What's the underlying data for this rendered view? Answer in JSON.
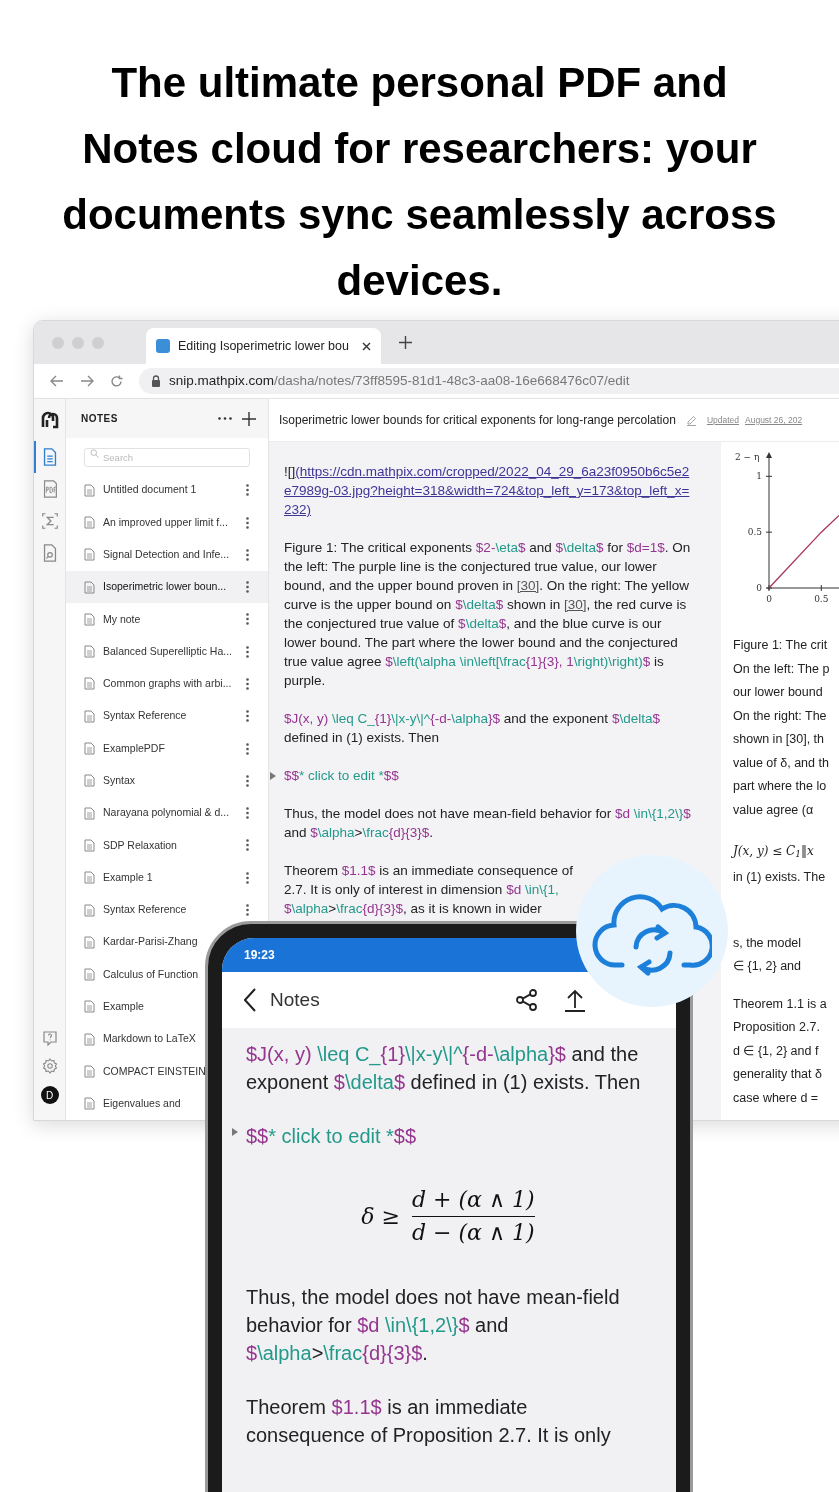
{
  "headline_lines": [
    "The ultimate personal PDF and",
    "Notes cloud for researchers: your",
    "documents sync seamlessly across",
    "devices."
  ],
  "browser": {
    "tab": {
      "title": "Editing Isoperimetric lower bou",
      "selected": true
    },
    "url_host": "snip.mathpix.com",
    "url_path": "/dasha/notes/73ff8595-81d1-48c3-aa08-16e668476c07/edit"
  },
  "rail": [
    {
      "kind": "notes",
      "selected": true
    },
    {
      "kind": "pdf",
      "selected": false
    },
    {
      "kind": "sigma",
      "selected": false
    },
    {
      "kind": "search-doc",
      "selected": false
    }
  ],
  "rail_bottom": {
    "avatar": "D"
  },
  "sidebar": {
    "title": "NOTES",
    "search_placeholder": "Search",
    "items": [
      {
        "title": "Untitled document 1",
        "selected": false
      },
      {
        "title": "An improved upper limit f...",
        "selected": false
      },
      {
        "title": "Signal Detection and Infe...",
        "selected": false
      },
      {
        "title": "Isoperimetric lower boun...",
        "selected": true
      },
      {
        "title": "My note",
        "selected": false
      },
      {
        "title": "Balanced Superelliptic Ha...",
        "selected": false
      },
      {
        "title": "Common graphs with arbi...",
        "selected": false
      },
      {
        "title": "Syntax Reference",
        "selected": false
      },
      {
        "title": "ExamplePDF",
        "selected": false
      },
      {
        "title": "Syntax",
        "selected": false
      },
      {
        "title": "Narayana polynomial & d...",
        "selected": false
      },
      {
        "title": "SDP Relaxation",
        "selected": false
      },
      {
        "title": "Example 1",
        "selected": false
      },
      {
        "title": "Syntax Reference",
        "selected": false
      },
      {
        "title": "Kardar-Parisi-Zhang",
        "selected": false
      },
      {
        "title": "Calculus of Function",
        "selected": false
      },
      {
        "title": "Example",
        "selected": false
      },
      {
        "title": "Markdown to LaTeX",
        "selected": false
      },
      {
        "title": "COMPACT EINSTEIN",
        "selected": false
      },
      {
        "title": "Eigenvalues and",
        "selected": false
      }
    ]
  },
  "document": {
    "title": "Isoperimetric lower bounds for critical exponents for long-range percolation",
    "updated_label": "Updated",
    "updated_date": "August 26, 202"
  },
  "editor": [
    {
      "kind": "para",
      "segments": [
        {
          "kind": "text",
          "text": "![]"
        },
        {
          "kind": "link",
          "text": "(https://cdn.mathpix.com/cropped/2022_04_29_6a23f0950b6c5e2e7989g-03.jpg?height=318&width=724&top_left_y=173&top_left_x=232)"
        }
      ]
    },
    {
      "kind": "para",
      "segments": [
        {
          "kind": "text",
          "text": "Figure 1: The critical exponents "
        },
        {
          "kind": "delim",
          "text": "$2-"
        },
        {
          "kind": "tex",
          "text": "\\eta"
        },
        {
          "kind": "delim",
          "text": "$"
        },
        {
          "kind": "text",
          "text": " and "
        },
        {
          "kind": "delim",
          "text": "$"
        },
        {
          "kind": "tex",
          "text": "\\delta"
        },
        {
          "kind": "delim",
          "text": "$"
        },
        {
          "kind": "text",
          "text": " for "
        },
        {
          "kind": "delim",
          "text": "$d=1$"
        },
        {
          "kind": "text",
          "text": ". On the left: The purple line is the conjectured true value, our lower bound, and the upper bound proven in "
        },
        {
          "kind": "ref",
          "text": "[30]"
        },
        {
          "kind": "text",
          "text": ". On the right: The yellow curve is the upper bound on "
        },
        {
          "kind": "delim",
          "text": "$"
        },
        {
          "kind": "tex",
          "text": "\\delta"
        },
        {
          "kind": "delim",
          "text": "$"
        },
        {
          "kind": "text",
          "text": " shown in "
        },
        {
          "kind": "ref",
          "text": "[30]"
        },
        {
          "kind": "text",
          "text": ", the red curve is the conjectured true value of "
        },
        {
          "kind": "delim",
          "text": "$"
        },
        {
          "kind": "tex",
          "text": "\\delta"
        },
        {
          "kind": "delim",
          "text": "$"
        },
        {
          "kind": "text",
          "text": ", and the blue curve is our lower bound. The part where the lower bound and the conjectured true value agree "
        },
        {
          "kind": "delim",
          "text": "$"
        },
        {
          "kind": "tex",
          "text": "\\left(\\alpha \\in\\left[\\frac"
        },
        {
          "kind": "delim",
          "text": "{1}{3}, 1"
        },
        {
          "kind": "tex",
          "text": "\\right)\\right)"
        },
        {
          "kind": "delim",
          "text": "$"
        },
        {
          "kind": "text",
          "text": " is purple."
        }
      ]
    },
    {
      "kind": "para",
      "segments": [
        {
          "kind": "delim",
          "text": "$J(x, y) "
        },
        {
          "kind": "tex",
          "text": "\\leq C_"
        },
        {
          "kind": "delim",
          "text": "{1}"
        },
        {
          "kind": "tex",
          "text": "\\|x-y\\|^"
        },
        {
          "kind": "delim",
          "text": "{-d-"
        },
        {
          "kind": "tex",
          "text": "\\alpha"
        },
        {
          "kind": "delim",
          "text": "}$"
        },
        {
          "kind": "text",
          "text": " and the exponent "
        },
        {
          "kind": "delim",
          "text": "$"
        },
        {
          "kind": "tex",
          "text": "\\delta"
        },
        {
          "kind": "delim",
          "text": "$"
        },
        {
          "kind": "text",
          "text": " defined in (1) exists. Then"
        }
      ]
    },
    {
      "kind": "collapsed",
      "segments": [
        {
          "kind": "delim",
          "text": "$$"
        },
        {
          "kind": "tex",
          "text": "* click to edit *"
        },
        {
          "kind": "delim",
          "text": "$$"
        }
      ]
    },
    {
      "kind": "para",
      "segments": [
        {
          "kind": "text",
          "text": "Thus, the model does not have mean-field behavior for "
        },
        {
          "kind": "delim",
          "text": "$d "
        },
        {
          "kind": "tex",
          "text": "\\in\\{1,2\\}"
        },
        {
          "kind": "delim",
          "text": "$"
        },
        {
          "kind": "text",
          "text": " and "
        },
        {
          "kind": "delim",
          "text": "$"
        },
        {
          "kind": "tex",
          "text": "\\alpha"
        },
        {
          "kind": "text",
          "text": ">"
        },
        {
          "kind": "tex",
          "text": "\\frac"
        },
        {
          "kind": "delim",
          "text": "{d}{3}$"
        },
        {
          "kind": "text",
          "text": "."
        }
      ]
    },
    {
      "kind": "clipped",
      "lines": [
        [
          {
            "kind": "text",
            "text": "Theorem "
          },
          {
            "kind": "delim",
            "text": "$1.1$"
          },
          {
            "kind": "text",
            "text": " is an immediate consequence of"
          }
        ],
        [
          {
            "kind": "text",
            "text": "2.7. It is only of interest in dimension "
          },
          {
            "kind": "delim",
            "text": "$d "
          },
          {
            "kind": "tex",
            "text": "\\in\\{1,"
          }
        ],
        [
          {
            "kind": "delim",
            "text": "$"
          },
          {
            "kind": "tex",
            "text": "\\alpha"
          },
          {
            "kind": "text",
            "text": ">"
          },
          {
            "kind": "tex",
            "text": "\\frac"
          },
          {
            "kind": "delim",
            "text": "{d}{3}$"
          },
          {
            "kind": "text",
            "text": ", as it is known in wider"
          }
        ]
      ]
    }
  ],
  "preview": {
    "chart_data": {
      "type": "line",
      "ylabel": "2 − η",
      "x": [
        0,
        0.5
      ],
      "series": [
        {
          "color": "#a8325e",
          "values": [
            0,
            0.5
          ]
        }
      ],
      "xlim": [
        0,
        0.65
      ],
      "ylim": [
        0,
        1.2
      ],
      "xticks": [
        0,
        0.5
      ],
      "yticks": [
        0,
        0.5,
        1
      ]
    },
    "lines": [
      {
        "kind": "text",
        "text": "Figure 1: The crit"
      },
      {
        "kind": "text",
        "text": "On the left: The p"
      },
      {
        "kind": "text",
        "text": "our lower bound"
      },
      {
        "kind": "text",
        "text": "On the right: The"
      },
      {
        "kind": "text",
        "text": "shown in [30], th"
      },
      {
        "kind": "text",
        "text": "value of δ, and th"
      },
      {
        "kind": "text",
        "text": "part where the lo"
      },
      {
        "kind": "text",
        "text": "value agree (α"
      },
      {
        "kind": "gap"
      },
      {
        "kind": "math",
        "text": "J(x, y) ≤ C$_{1}$‖x"
      },
      {
        "kind": "text",
        "text": "in (1) exists. The"
      },
      {
        "kind": "gap"
      },
      {
        "kind": "gap"
      },
      {
        "kind": "gap"
      },
      {
        "kind": "text",
        "text": "s, the model"
      },
      {
        "kind": "text",
        "text": "∈ {1, 2} and"
      },
      {
        "kind": "gap"
      },
      {
        "kind": "text",
        "text": "Theorem 1.1 is a"
      },
      {
        "kind": "text",
        "text": "Proposition 2.7."
      },
      {
        "kind": "text",
        "text": "d ∈ {1, 2} and f"
      },
      {
        "kind": "text",
        "text": "generality that δ"
      },
      {
        "kind": "text",
        "text": "case where d ="
      }
    ]
  },
  "phone": {
    "time": "19:23",
    "back_label": "Notes",
    "content": [
      {
        "kind": "para",
        "segments": [
          {
            "kind": "delim",
            "text": "$J(x, y) "
          },
          {
            "kind": "tex",
            "text": "\\leq C_"
          },
          {
            "kind": "delim",
            "text": "{1}"
          },
          {
            "kind": "tex",
            "text": "\\|x-y\\|^"
          },
          {
            "kind": "delim",
            "text": "{-d-"
          },
          {
            "kind": "tex",
            "text": "\\alpha"
          },
          {
            "kind": "delim",
            "text": "}$"
          },
          {
            "kind": "text",
            "text": " and the exponent "
          },
          {
            "kind": "delim",
            "text": "$"
          },
          {
            "kind": "tex",
            "text": "\\delta"
          },
          {
            "kind": "delim",
            "text": "$"
          },
          {
            "kind": "text",
            "text": " defined in (1) exists. Then"
          }
        ]
      },
      {
        "kind": "collapsed",
        "segments": [
          {
            "kind": "delim",
            "text": "$$"
          },
          {
            "kind": "tex",
            "text": "* click to edit *"
          },
          {
            "kind": "delim",
            "text": "$$"
          }
        ]
      },
      {
        "kind": "formula",
        "lhs": "δ ≥",
        "numerator": "d + (α ∧ 1)",
        "denominator": "d − (α ∧ 1)"
      },
      {
        "kind": "para",
        "segments": [
          {
            "kind": "text",
            "text": "Thus, the model does not have mean-field behavior for "
          },
          {
            "kind": "delim",
            "text": "$d "
          },
          {
            "kind": "tex",
            "text": "\\in\\{1,2\\}"
          },
          {
            "kind": "delim",
            "text": "$"
          },
          {
            "kind": "text",
            "text": " and "
          },
          {
            "kind": "delim",
            "text": "$"
          },
          {
            "kind": "tex",
            "text": "\\alpha"
          },
          {
            "kind": "text",
            "text": ">"
          },
          {
            "kind": "tex",
            "text": "\\frac"
          },
          {
            "kind": "delim",
            "text": "{d}{3}$"
          },
          {
            "kind": "text",
            "text": "."
          }
        ]
      },
      {
        "kind": "para",
        "segments": [
          {
            "kind": "text",
            "text": "Theorem "
          },
          {
            "kind": "delim",
            "text": "$1.1$"
          },
          {
            "kind": "text",
            "text": " is an immediate consequence of Proposition 2.7. It is only"
          }
        ]
      }
    ]
  }
}
